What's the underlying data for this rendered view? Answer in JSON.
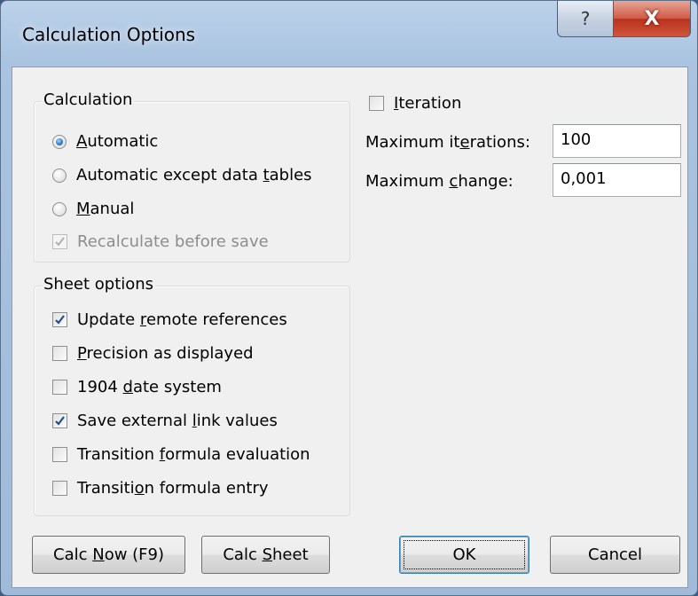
{
  "window": {
    "title": "Calculation Options",
    "help_button": "?",
    "close_button": "X"
  },
  "calculation": {
    "group_label": "Calculation",
    "options": [
      {
        "label_pre": "",
        "label_u": "A",
        "label_post": "utomatic",
        "selected": true
      },
      {
        "label_pre": "Automatic except data ",
        "label_u": "t",
        "label_post": "ables",
        "selected": false
      },
      {
        "label_pre": "",
        "label_u": "M",
        "label_post": "anual",
        "selected": false
      }
    ],
    "recalculate": {
      "label": "Recalculate before save",
      "checked": true,
      "enabled": false
    }
  },
  "iteration": {
    "label_u": "I",
    "label_post": "teration",
    "checked": false,
    "max_iterations_label_pre": "Maximum it",
    "max_iterations_label_u": "e",
    "max_iterations_label_post": "rations:",
    "max_iterations_value": "100",
    "max_change_label_pre": "Maximum ",
    "max_change_label_u": "c",
    "max_change_label_post": "hange:",
    "max_change_value": "0,001"
  },
  "sheet_options": {
    "group_label": "Sheet options",
    "items": [
      {
        "label_pre": "Update ",
        "label_u": "r",
        "label_post": "emote references",
        "checked": true
      },
      {
        "label_pre": "",
        "label_u": "P",
        "label_post": "recision as displayed",
        "checked": false
      },
      {
        "label_pre": "1904 ",
        "label_u": "d",
        "label_post": "ate system",
        "checked": false
      },
      {
        "label_pre": "Save external ",
        "label_u": "l",
        "label_post": "ink values",
        "checked": true
      },
      {
        "label_pre": "Transition ",
        "label_u": "f",
        "label_post": "ormula evaluation",
        "checked": false
      },
      {
        "label_pre": "Transiti",
        "label_u": "o",
        "label_post": "n formula entry",
        "checked": false
      }
    ]
  },
  "buttons": {
    "calc_now_pre": "Calc ",
    "calc_now_u": "N",
    "calc_now_post": "ow (F9)",
    "calc_sheet_pre": "Calc ",
    "calc_sheet_u": "S",
    "calc_sheet_post": "heet",
    "ok": "OK",
    "cancel": "Cancel"
  }
}
